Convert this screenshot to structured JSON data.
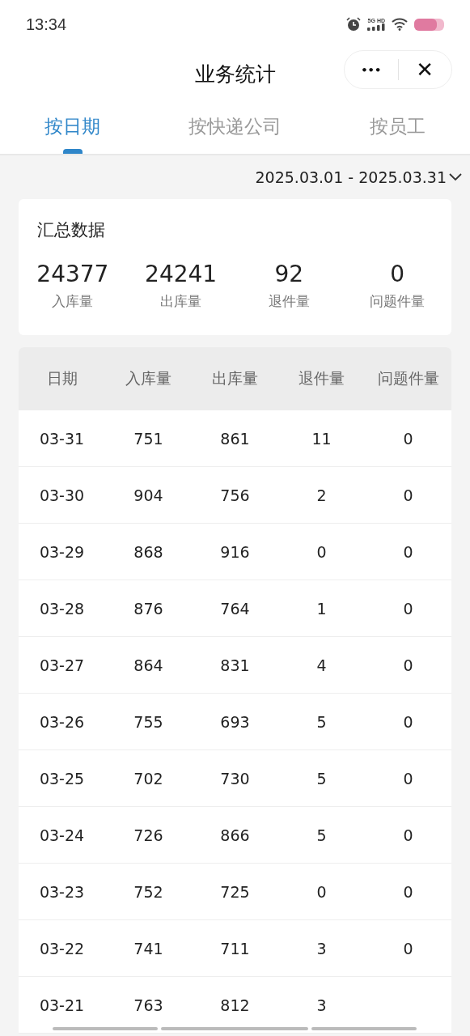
{
  "status_bar": {
    "time": "13:34",
    "network": "5G HD"
  },
  "header": {
    "title": "业务统计",
    "more_button": "•••",
    "close_button": "✕"
  },
  "tabs": [
    {
      "label": "按日期",
      "selected": true
    },
    {
      "label": "按快递公司",
      "selected": false
    },
    {
      "label": "按员工",
      "selected": false
    }
  ],
  "date_range": "2025.03.01 - 2025.03.31",
  "summary": {
    "title": "汇总数据",
    "stats": [
      {
        "value": "24377",
        "label": "入库量"
      },
      {
        "value": "24241",
        "label": "出库量"
      },
      {
        "value": "92",
        "label": "退件量"
      },
      {
        "value": "0",
        "label": "问题件量"
      }
    ]
  },
  "table": {
    "columns": [
      "日期",
      "入库量",
      "出库量",
      "退件量",
      "问题件量"
    ],
    "rows": [
      [
        "03-31",
        "751",
        "861",
        "11",
        "0"
      ],
      [
        "03-30",
        "904",
        "756",
        "2",
        "0"
      ],
      [
        "03-29",
        "868",
        "916",
        "0",
        "0"
      ],
      [
        "03-28",
        "876",
        "764",
        "1",
        "0"
      ],
      [
        "03-27",
        "864",
        "831",
        "4",
        "0"
      ],
      [
        "03-26",
        "755",
        "693",
        "5",
        "0"
      ],
      [
        "03-25",
        "702",
        "730",
        "5",
        "0"
      ],
      [
        "03-24",
        "726",
        "866",
        "5",
        "0"
      ],
      [
        "03-23",
        "752",
        "725",
        "0",
        "0"
      ],
      [
        "03-22",
        "741",
        "711",
        "3",
        "0"
      ],
      [
        "03-21",
        "763",
        "812",
        "3"
      ]
    ]
  }
}
